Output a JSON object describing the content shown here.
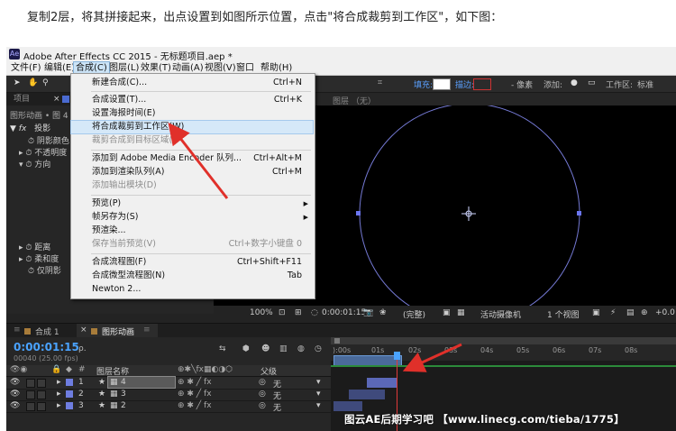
{
  "caption": "复制2层，将其拼接起来，出点设置到如图所示位置，点击\"将合成裁剪到工作区\"，如下图：",
  "window": {
    "app_icon": "Ae",
    "title": "Adobe After Effects CC 2015 - 无标题项目.aep *"
  },
  "menubar": [
    "文件(F)",
    "编辑(E)",
    "合成(C)",
    "图层(L)",
    "效果(T)",
    "动画(A)",
    "视图(V)",
    "窗口",
    "帮助(H)"
  ],
  "toolbar": {
    "fill_label": "填充:",
    "stroke_label": "描边:",
    "px_label": "- 像素",
    "add_label": "添加:",
    "workspace_label": "工作区:",
    "workspace_value": "标准"
  },
  "left_panel": {
    "tab_project": "项目",
    "effect_title": "图形动画 • 图 4",
    "fx_name": "投影",
    "props": [
      "阴影颜色",
      "不透明度",
      "方向",
      "距离",
      "柔和度",
      "仅阴影"
    ]
  },
  "viewer": {
    "header": "图层 （无）",
    "zoom": "100%",
    "timecode": "0:00:01:15",
    "quality": "(完整)",
    "camera": "活动摄像机",
    "views": "1 个视图",
    "exposure": "+0.0"
  },
  "composition_menu": {
    "items": [
      {
        "label": "新建合成(C)...",
        "shortcut": "Ctrl+N",
        "disabled": false
      },
      {
        "label": "合成设置(T)...",
        "shortcut": "Ctrl+K",
        "disabled": false
      },
      {
        "label": "设置海报时间(E)",
        "shortcut": "",
        "disabled": false
      },
      {
        "label": "将合成裁剪到工作区(W)",
        "shortcut": "",
        "disabled": false
      },
      {
        "label": "裁剪合成到目标区域(I)",
        "shortcut": "",
        "disabled": true
      },
      {
        "label": "添加到 Adobe Media Encoder 队列...",
        "shortcut": "Ctrl+Alt+M",
        "disabled": false
      },
      {
        "label": "添加到渲染队列(A)",
        "shortcut": "Ctrl+M",
        "disabled": false
      },
      {
        "label": "添加输出模块(D)",
        "shortcut": "",
        "disabled": true
      },
      {
        "label": "预览(P)",
        "shortcut": "",
        "disabled": false
      },
      {
        "label": "帧另存为(S)",
        "shortcut": "",
        "disabled": false
      },
      {
        "label": "预渲染...",
        "shortcut": "",
        "disabled": false
      },
      {
        "label": "保存当前预览(V)",
        "shortcut": "Ctrl+数字小键盘 0",
        "disabled": true
      },
      {
        "label": "合成流程图(F)",
        "shortcut": "Ctrl+Shift+F11",
        "disabled": false
      },
      {
        "label": "合成微型流程图(N)",
        "shortcut": "Tab",
        "disabled": false
      },
      {
        "label": "Newton 2...",
        "shortcut": "",
        "disabled": false
      }
    ]
  },
  "timeline": {
    "tabs": [
      "合成 1",
      "图形动画"
    ],
    "timecode": "0:00:01:15",
    "fps": "00040 (25.00 fps)",
    "search_placeholder": "ρ.",
    "col_layer_name": "图层名称",
    "col_parent": "父级",
    "ruler": [
      "):00s",
      "01s",
      "02s",
      "03s",
      "04s",
      "05s",
      "06s",
      "07s",
      "08s"
    ],
    "layers": [
      {
        "num": "1",
        "name": "4",
        "parent": "无"
      },
      {
        "num": "2",
        "name": "3",
        "parent": "无"
      },
      {
        "num": "3",
        "name": "2",
        "parent": "无"
      }
    ]
  },
  "watermark": "图云AE后期学习吧 【www.linecg.com/tieba/1775】",
  "colors": {
    "highlight": "#d5e8f8",
    "arrow": "#e0302a",
    "label_blue": "#6e7de0",
    "clip": "#4a5a9a"
  }
}
